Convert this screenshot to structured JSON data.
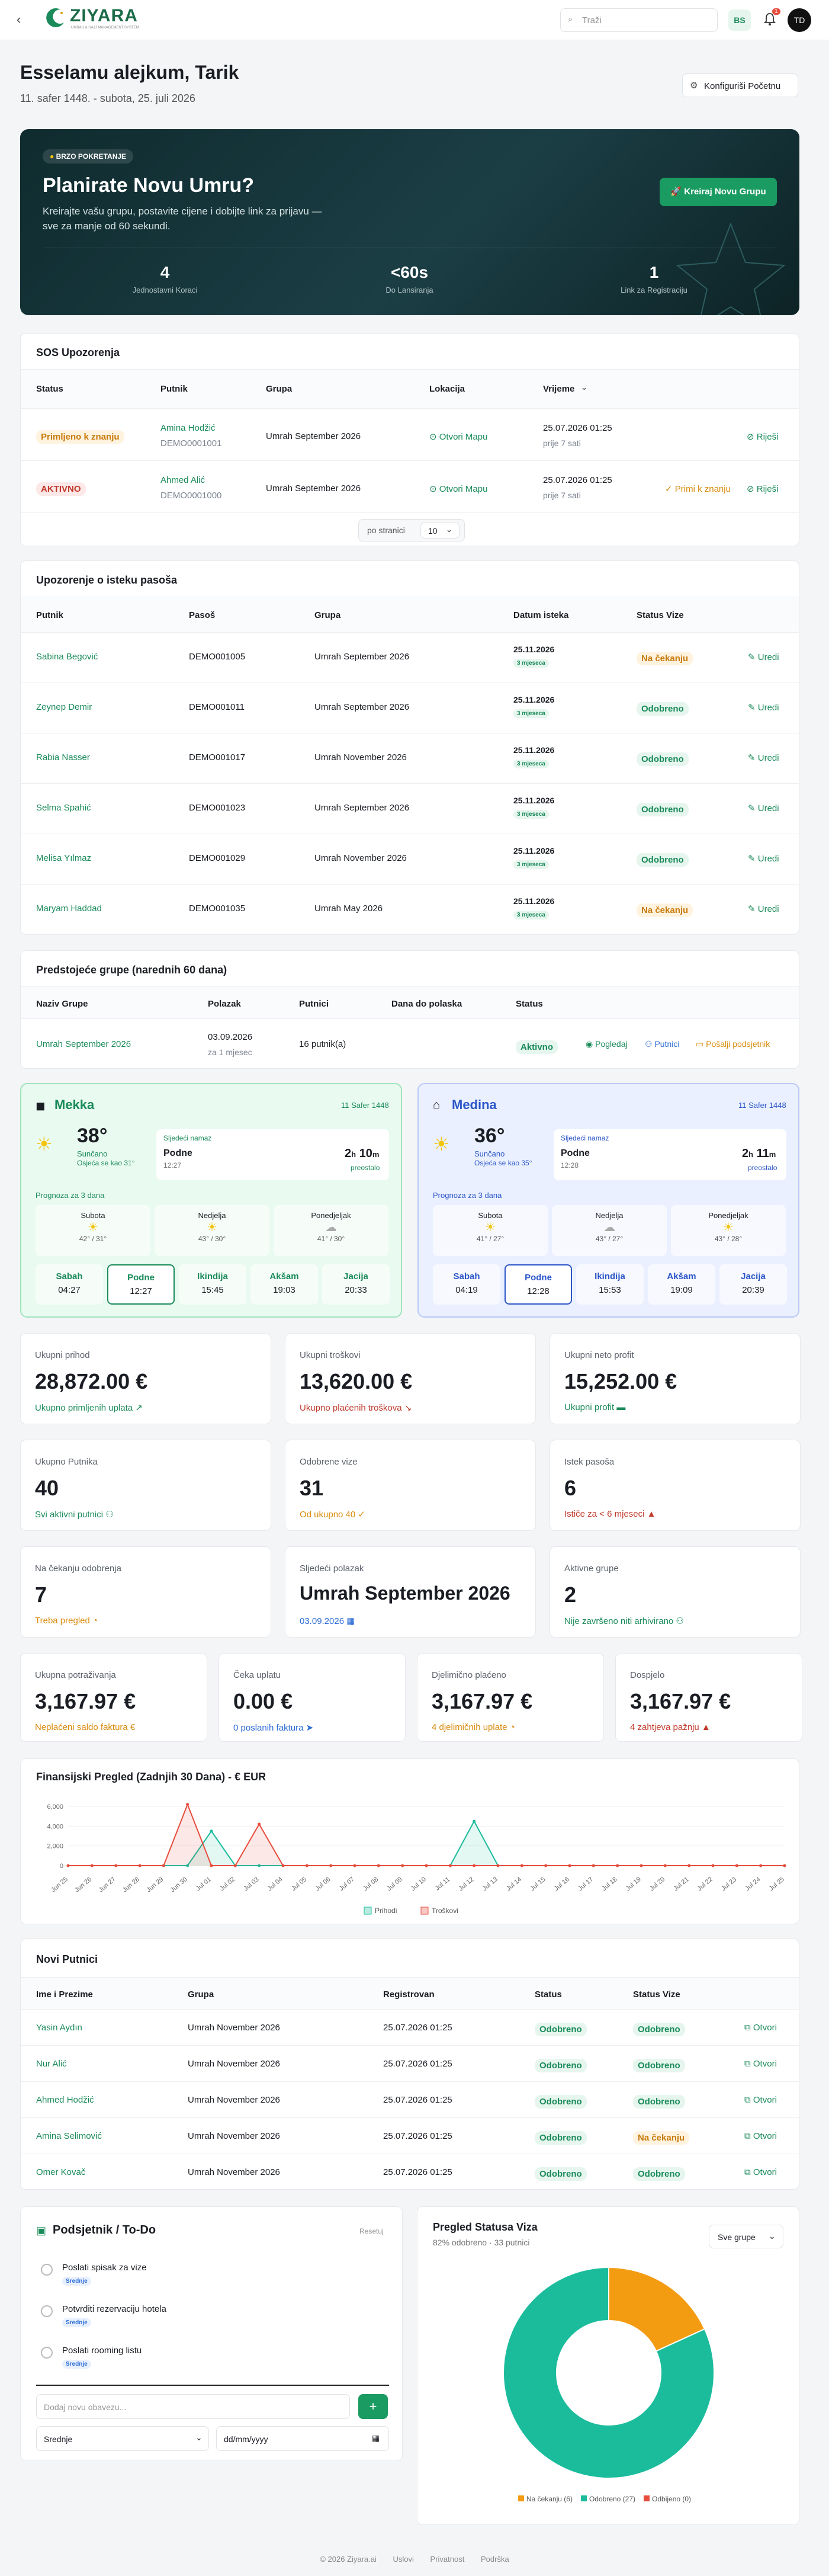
{
  "header": {
    "logo_text": "ZIYARA",
    "logo_sub": "UMRAH & HAJJ MANAGEMENT SYSTEM",
    "search_placeholder": "Traži",
    "lang": "BS",
    "notif_count": "1",
    "avatar": "TD"
  },
  "greeting": {
    "title": "Esselamu alejkum, Tarik",
    "date": "11. safer 1448. - subota, 25. juli 2026",
    "config_button": "Konfiguriši Početnu"
  },
  "hero": {
    "badge": "BRZO POKRETANJE",
    "title": "Planirate Novu Umru?",
    "text": "Kreirajte vašu grupu, postavite cijene i dobijte link za prijavu — sve za manje od 60 sekundi.",
    "button": "Kreiraj Novu Grupu",
    "stats": [
      {
        "value": "4",
        "label": "Jednostavni Koraci"
      },
      {
        "value": "<60s",
        "label": "Do Lansiranja"
      },
      {
        "value": "1",
        "label": "Link za Registraciju"
      }
    ]
  },
  "sos": {
    "title": "SOS Upozorenja",
    "headers": [
      "Status",
      "Putnik",
      "Grupa",
      "Lokacija",
      "Vrijeme"
    ],
    "rows": [
      {
        "status": "Primljeno k znanju",
        "status_color": "yellow",
        "name": "Amina Hodžić",
        "id": "DEMO0001001",
        "group": "Umrah September 2026",
        "location": "Otvori Mapu",
        "time": "25.07.2026 01:25",
        "ago": "prije 7 sati",
        "ack": "",
        "resolve": "Riješi"
      },
      {
        "status": "AKTIVNO",
        "status_color": "red",
        "name": "Ahmed Alić",
        "id": "DEMO0001000",
        "group": "Umrah September 2026",
        "location": "Otvori Mapu",
        "time": "25.07.2026 01:25",
        "ago": "prije 7 sati",
        "ack": "Primi k znanju",
        "resolve": "Riješi"
      }
    ],
    "per_page_label": "po stranici",
    "per_page": "10"
  },
  "passport": {
    "title": "Upozorenje o isteku pasoša",
    "headers": [
      "Putnik",
      "Pasoš",
      "Grupa",
      "Datum isteka",
      "Status Vize"
    ],
    "rows": [
      {
        "name": "Sabina Begović",
        "pass": "DEMO001005",
        "group": "Umrah September 2026",
        "date": "25.11.2026",
        "months": "3 mjeseca",
        "visa": "Na čekanju",
        "visa_color": "yellow",
        "edit": "Uredi"
      },
      {
        "name": "Zeynep Demir",
        "pass": "DEMO001011",
        "group": "Umrah September 2026",
        "date": "25.11.2026",
        "months": "3 mjeseca",
        "visa": "Odobreno",
        "visa_color": "green",
        "edit": "Uredi"
      },
      {
        "name": "Rabia Nasser",
        "pass": "DEMO001017",
        "group": "Umrah November 2026",
        "date": "25.11.2026",
        "months": "3 mjeseca",
        "visa": "Odobreno",
        "visa_color": "green",
        "edit": "Uredi"
      },
      {
        "name": "Selma Spahić",
        "pass": "DEMO001023",
        "group": "Umrah September 2026",
        "date": "25.11.2026",
        "months": "3 mjeseca",
        "visa": "Odobreno",
        "visa_color": "green",
        "edit": "Uredi"
      },
      {
        "name": "Melisa Yılmaz",
        "pass": "DEMO001029",
        "group": "Umrah November 2026",
        "date": "25.11.2026",
        "months": "3 mjeseca",
        "visa": "Odobreno",
        "visa_color": "green",
        "edit": "Uredi"
      },
      {
        "name": "Maryam Haddad",
        "pass": "DEMO001035",
        "group": "Umrah May 2026",
        "date": "25.11.2026",
        "months": "3 mjeseca",
        "visa": "Na čekanju",
        "visa_color": "yellow",
        "edit": "Uredi"
      }
    ]
  },
  "upcoming": {
    "title": "Predstojeće grupe (narednih 60 dana)",
    "headers": [
      "Naziv Grupe",
      "Polazak",
      "Putnici",
      "Dana do polaska",
      "Status"
    ],
    "rows": [
      {
        "name": "Umrah September 2026",
        "date": "03.09.2026",
        "rel": "za 1 mjesec",
        "pax": "16 putnik(a)",
        "days": "",
        "status": "Aktivno",
        "view": "Pogledaj",
        "pax_link": "Putnici",
        "remind": "Pošalji podsjetnik"
      }
    ]
  },
  "weather": [
    {
      "city": "Mekka",
      "hijri": "11 Safer 1448",
      "temp": "38°",
      "cond": "Sunčano",
      "feels": "Osjeća se kao 31°",
      "next_label": "Sljedeći namaz",
      "next_name": "Podne",
      "next_time": "12:27",
      "countdown_h": "2",
      "countdown_m": "10",
      "countdown_label": "preostalo",
      "forecast_title": "Prognoza za 3 dana",
      "forecast": [
        {
          "day": "Subota",
          "range": "42° / 31°",
          "icon": "sun"
        },
        {
          "day": "Nedjelja",
          "range": "43° / 30°",
          "icon": "sun"
        },
        {
          "day": "Ponedjeljak",
          "range": "41° / 30°",
          "icon": "cloud"
        }
      ],
      "prayers": [
        {
          "name": "Sabah",
          "time": "04:27"
        },
        {
          "name": "Podne",
          "time": "12:27"
        },
        {
          "name": "Ikindija",
          "time": "15:45"
        },
        {
          "name": "Akšam",
          "time": "19:03"
        },
        {
          "name": "Jacija",
          "time": "20:33"
        }
      ],
      "active": 1
    },
    {
      "city": "Medina",
      "hijri": "11 Safer 1448",
      "temp": "36°",
      "cond": "Sunčano",
      "feels": "Osjeća se kao 35°",
      "next_label": "Sljedeći namaz",
      "next_name": "Podne",
      "next_time": "12:28",
      "countdown_h": "2",
      "countdown_m": "11",
      "countdown_label": "preostalo",
      "forecast_title": "Prognoza za 3 dana",
      "forecast": [
        {
          "day": "Subota",
          "range": "41° / 27°",
          "icon": "sun"
        },
        {
          "day": "Nedjelja",
          "range": "43° / 27°",
          "icon": "cloud"
        },
        {
          "day": "Ponedjeljak",
          "range": "43° / 28°",
          "icon": "sun"
        }
      ],
      "prayers": [
        {
          "name": "Sabah",
          "time": "04:19"
        },
        {
          "name": "Podne",
          "time": "12:28"
        },
        {
          "name": "Ikindija",
          "time": "15:53"
        },
        {
          "name": "Akšam",
          "time": "19:09"
        },
        {
          "name": "Jacija",
          "time": "20:39"
        }
      ],
      "active": 1
    }
  ],
  "stats1": [
    {
      "label": "Ukupni prihod",
      "value": "28,872.00 €",
      "sub": "Ukupno primljenih uplata",
      "color": "#1a8a5a"
    },
    {
      "label": "Ukupni troškovi",
      "value": "13,620.00 €",
      "sub": "Ukupno plaćenih troškova",
      "color": "#c0392b"
    },
    {
      "label": "Ukupni neto profit",
      "value": "15,252.00 €",
      "sub": "Ukupni profit",
      "color": "#1a8a5a"
    }
  ],
  "stats2": [
    {
      "label": "Ukupno Putnika",
      "value": "40",
      "sub": "Svi aktivni putnici",
      "color": "#1a8a5a"
    },
    {
      "label": "Odobrene vize",
      "value": "31",
      "sub": "Od ukupno 40",
      "color": "#d98a0c"
    },
    {
      "label": "Istek pasoša",
      "value": "6",
      "sub": "Ističe za < 6 mjeseci",
      "color": "#c0392b"
    }
  ],
  "stats3": [
    {
      "label": "Na čekanju odobrenja",
      "value": "7",
      "sub": "Treba pregled",
      "color": "#d98a0c"
    },
    {
      "label": "Sljedeći polazak",
      "value": "Umrah September 2026",
      "sub": "03.09.2026",
      "color": "#2b6cd6"
    },
    {
      "label": "Aktivne grupe",
      "value": "2",
      "sub": "Nije završeno niti arhivirano",
      "color": "#1a8a5a"
    }
  ],
  "stats4": [
    {
      "label": "Ukupna potraživanja",
      "value": "3,167.97 €",
      "sub": "Neplaćeni saldo faktura",
      "color": "#d98a0c"
    },
    {
      "label": "Čeka uplatu",
      "value": "0.00 €",
      "sub": "0 poslanih faktura",
      "color": "#2b6cd6"
    },
    {
      "label": "Djelimično plaćeno",
      "value": "3,167.97 €",
      "sub": "4 djelimičnih uplate",
      "color": "#d98a0c"
    },
    {
      "label": "Dospjelo",
      "value": "3,167.97 €",
      "sub": "4 zahtjeva pažnju",
      "color": "#c0392b"
    }
  ],
  "chart_data": {
    "type": "line",
    "title": "Finansijski Pregled (Zadnjih 30 Dana) - € EUR",
    "categories": [
      "Jun 25",
      "Jun 26",
      "Jun 27",
      "Jun 28",
      "Jun 29",
      "Jun 30",
      "Jul 01",
      "Jul 02",
      "Jul 03",
      "Jul 04",
      "Jul 05",
      "Jul 06",
      "Jul 07",
      "Jul 08",
      "Jul 09",
      "Jul 10",
      "Jul 11",
      "Jul 12",
      "Jul 13",
      "Jul 14",
      "Jul 15",
      "Jul 16",
      "Jul 17",
      "Jul 18",
      "Jul 19",
      "Jul 20",
      "Jul 21",
      "Jul 22",
      "Jul 23",
      "Jul 24",
      "Jul 25"
    ],
    "ylim": [
      0,
      6000
    ],
    "yticks": [
      "0",
      "2,000",
      "4,000",
      "6,000"
    ],
    "series": [
      {
        "name": "Prihodi",
        "color": "#1abc9c",
        "values": [
          0,
          0,
          0,
          0,
          0,
          0,
          3500,
          0,
          0,
          0,
          0,
          0,
          0,
          0,
          0,
          0,
          0,
          4500,
          0,
          0,
          0,
          0,
          0,
          0,
          0,
          0,
          0,
          0,
          0,
          0,
          0
        ]
      },
      {
        "name": "Troškovi",
        "color": "#e74c3c",
        "values": [
          0,
          0,
          0,
          0,
          0,
          6200,
          0,
          0,
          4200,
          0,
          0,
          0,
          0,
          0,
          0,
          0,
          0,
          0,
          0,
          0,
          0,
          0,
          0,
          0,
          0,
          0,
          0,
          0,
          0,
          0,
          0
        ]
      }
    ],
    "legend": "bottom"
  },
  "new_pax": {
    "title": "Novi Putnici",
    "headers": [
      "Ime i Prezime",
      "Grupa",
      "Registrovan",
      "Status",
      "Status Vize"
    ],
    "rows": [
      {
        "name": "Yasin Aydın",
        "group": "Umrah November 2026",
        "date": "25.07.2026 01:25",
        "status": "Odobreno",
        "visa": "Odobreno",
        "visa_color": "green",
        "open": "Otvori"
      },
      {
        "name": "Nur Alić",
        "group": "Umrah November 2026",
        "date": "25.07.2026 01:25",
        "status": "Odobreno",
        "visa": "Odobreno",
        "visa_color": "green",
        "open": "Otvori"
      },
      {
        "name": "Ahmed Hodžić",
        "group": "Umrah November 2026",
        "date": "25.07.2026 01:25",
        "status": "Odobreno",
        "visa": "Odobreno",
        "visa_color": "green",
        "open": "Otvori"
      },
      {
        "name": "Amina Selimović",
        "group": "Umrah November 2026",
        "date": "25.07.2026 01:25",
        "status": "Odobreno",
        "visa": "Na čekanju",
        "visa_color": "yellow",
        "open": "Otvori"
      },
      {
        "name": "Omer Kovač",
        "group": "Umrah November 2026",
        "date": "25.07.2026 01:25",
        "status": "Odobreno",
        "visa": "Odobreno",
        "visa_color": "green",
        "open": "Otvori"
      }
    ]
  },
  "todo": {
    "title": "Podsjetnik / To-Do",
    "reset": "Resetuj",
    "items": [
      {
        "text": "Poslati spisak za vize",
        "priority": "Srednje"
      },
      {
        "text": "Potvrditi rezervaciju hotela",
        "priority": "Srednje"
      },
      {
        "text": "Poslati rooming listu",
        "priority": "Srednje"
      }
    ],
    "input_placeholder": "Dodaj novu obavezu...",
    "priority_select": "Srednje",
    "date_placeholder": "dd/mm/yyyy"
  },
  "visa": {
    "title": "Pregled Statusa Viza",
    "subtitle": "82% odobreno · 33 putnici",
    "filter": "Sve grupe",
    "segments": [
      {
        "label": "Na čekanju (6)",
        "value": 6,
        "color": "#f39c12"
      },
      {
        "label": "Odobreno (27)",
        "value": 27,
        "color": "#1abc9c"
      },
      {
        "label": "Odbijeno (0)",
        "value": 0,
        "color": "#e74c3c"
      }
    ]
  },
  "footer": {
    "copyright": "© 2026 Ziyara.ai",
    "links": [
      "Uslovi",
      "Privatnost",
      "Podrška"
    ]
  }
}
